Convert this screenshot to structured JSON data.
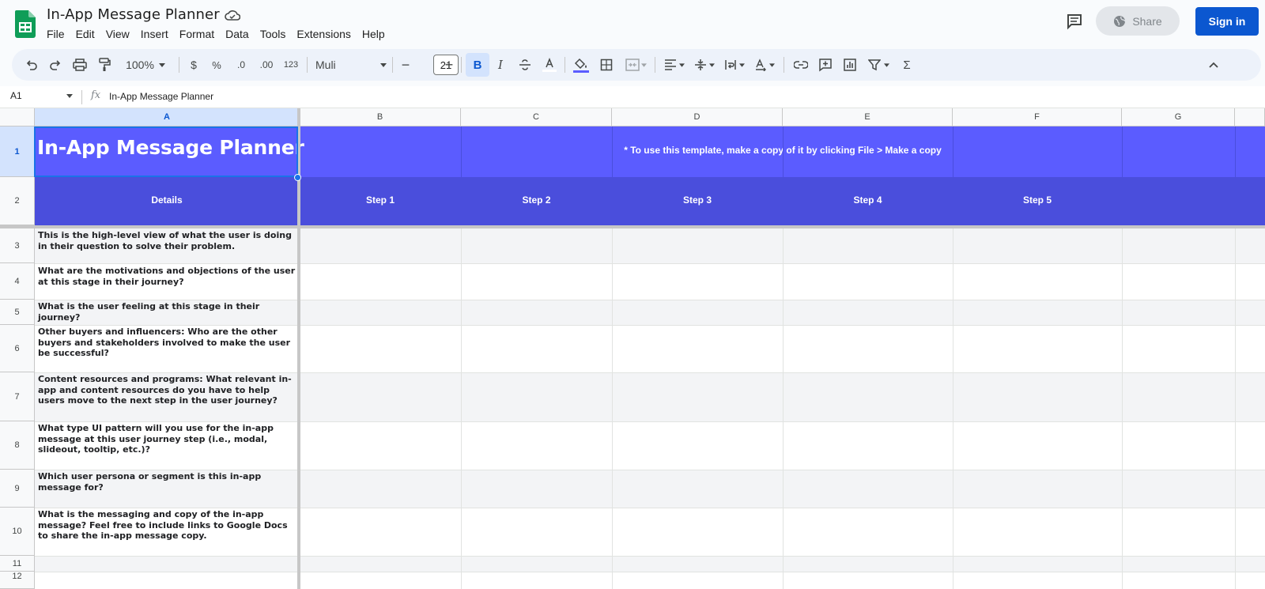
{
  "app": {
    "title": "In-App Message Planner",
    "menu": [
      "File",
      "Edit",
      "View",
      "Insert",
      "Format",
      "Data",
      "Tools",
      "Extensions",
      "Help"
    ],
    "share_label": "Share",
    "signin_label": "Sign in",
    "accent_color": "#0b57d0"
  },
  "toolbar": {
    "zoom": "100%",
    "currency": "$",
    "percent": "%",
    "decimal_decrease": ".0",
    "decimal_increase": ".00",
    "format_123": "123",
    "font": "Muli",
    "font_size": "21",
    "minus": "−",
    "plus": "+",
    "bold": "B",
    "italic": "I",
    "sum": "Σ"
  },
  "formula_bar": {
    "cell_ref": "A1",
    "fx": "fx",
    "content": "In-App Message Planner"
  },
  "columns": [
    "A",
    "B",
    "C",
    "D",
    "E",
    "F",
    "G"
  ],
  "rows": [
    "1",
    "2",
    "3",
    "4",
    "5",
    "6",
    "7",
    "8",
    "9",
    "10",
    "11",
    "12"
  ],
  "sheet": {
    "title": "In-App Message Planner",
    "note": "* To use this template, make a copy of it by clicking File > Make a copy",
    "details_header": "Details",
    "steps": [
      "Step 1",
      "Step 2",
      "Step 3",
      "Step 4",
      "Step 5"
    ],
    "questions": [
      "This is the high-level view of what the user is doing in their question to solve their problem.",
      "What are the motivations and objections of the user at this stage in their journey?",
      "What is the user feeling at this stage in their journey?",
      "Other buyers and influencers: Who are the other buyers and stakeholders involved to make the user be successful?",
      "Content resources and programs: What relevant in-app and content resources do you have to help users move to the next step in the user journey?",
      "What type UI pattern will you use for the in-app message at this user journey step (i.e., modal, slideout, tooltip, etc.)?",
      "Which user persona or segment is this in-app message for?",
      "What is the messaging and copy of the in-app message? Feel free to include links to Google Docs to share the in-app message copy."
    ],
    "title_band_color": "#5b5cff",
    "step_band_color": "#4a4edc"
  }
}
